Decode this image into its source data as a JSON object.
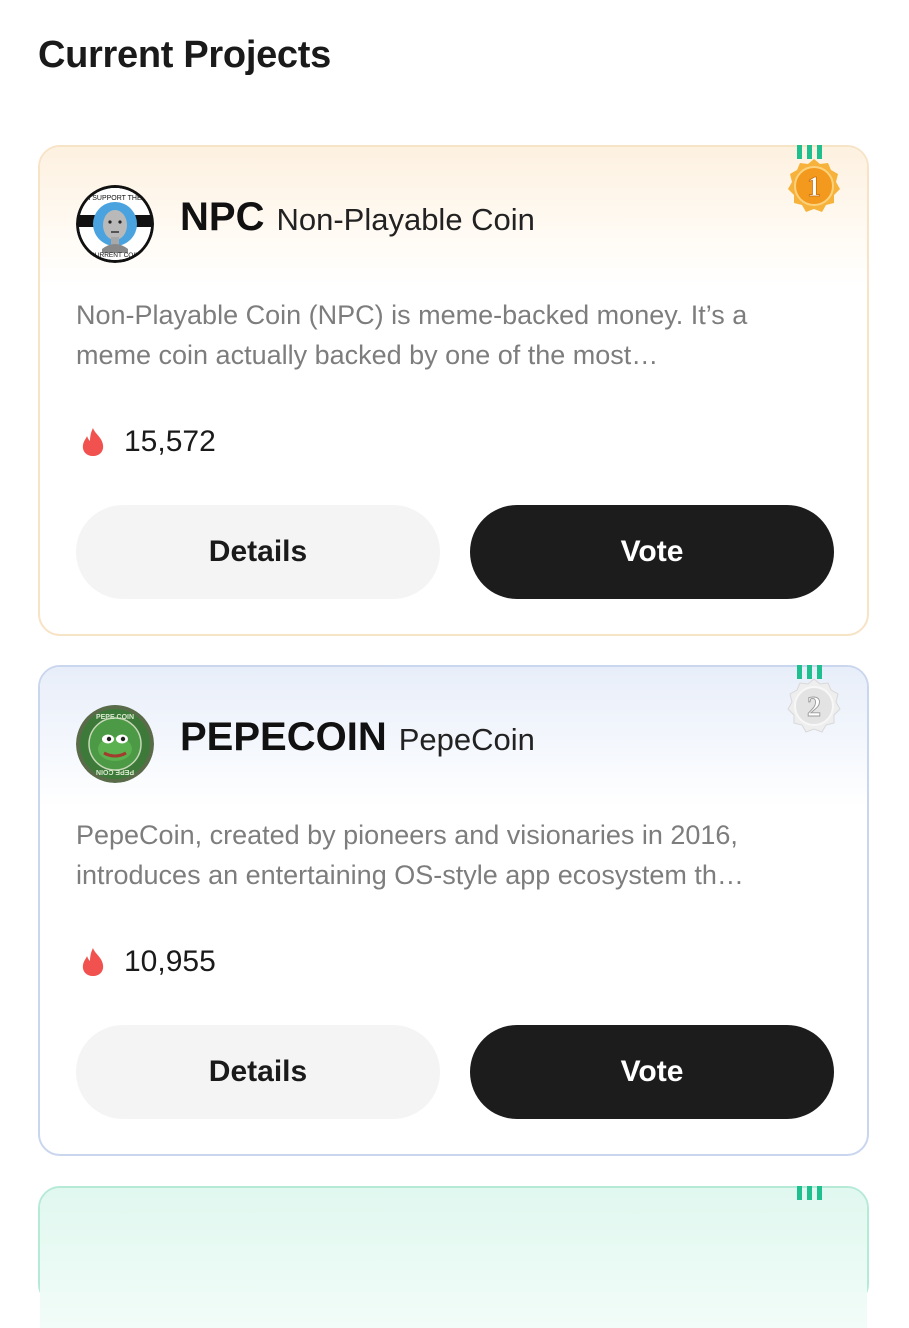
{
  "page": {
    "title": "Current Projects"
  },
  "colors": {
    "gold_medal": "#f39a1e",
    "silver_medal": "#e3e3e3",
    "ribbon": "#1fbf8f",
    "flame": "#f2524f",
    "vote_button": "#1c1c1c"
  },
  "projects": [
    {
      "rank": "1",
      "medal": "gold",
      "ticker": "NPC",
      "name": "Non-Playable Coin",
      "logo_icon": "npc-logo",
      "logo_text_top": "I SUPPORT THE",
      "logo_text_bottom": "CURRENT COIN",
      "description_line1": "Non-Playable Coin (NPC) is meme-backed money. It’s a",
      "description_line2": "meme coin actually backed by one of the most…",
      "votes": "15,572",
      "details_label": "Details",
      "vote_label": "Vote"
    },
    {
      "rank": "2",
      "medal": "silver",
      "ticker": "PEPECOIN",
      "name": "PepeCoin",
      "logo_icon": "pepecoin-logo",
      "logo_text_top": "PEPE COIN",
      "logo_text_bottom": "PEPE COIN",
      "description_line1": "PepeCoin, created by pioneers and visionaries in 2016,",
      "description_line2": "introduces an entertaining OS-style app ecosystem th…",
      "votes": "10,955",
      "details_label": "Details",
      "vote_label": "Vote"
    }
  ]
}
